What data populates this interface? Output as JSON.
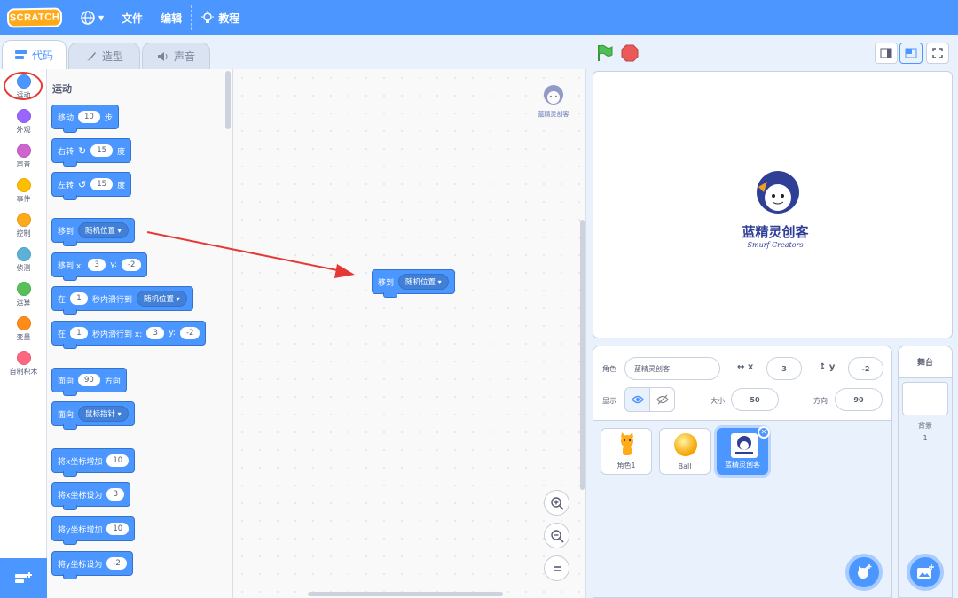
{
  "menubar": {
    "logo": "SCRATCH",
    "file": "文件",
    "edit": "编辑",
    "tutorials": "教程"
  },
  "tabs": [
    {
      "label": "代码"
    },
    {
      "label": "造型"
    },
    {
      "label": "声音"
    }
  ],
  "categories": [
    {
      "label": "运动",
      "color": "#4c97ff"
    },
    {
      "label": "外观",
      "color": "#9966ff"
    },
    {
      "label": "声音",
      "color": "#cf63cf"
    },
    {
      "label": "事件",
      "color": "#ffbf00"
    },
    {
      "label": "控制",
      "color": "#ffab19"
    },
    {
      "label": "侦测",
      "color": "#5cb1d6"
    },
    {
      "label": "运算",
      "color": "#59c059"
    },
    {
      "label": "变量",
      "color": "#ff8c1a"
    },
    {
      "label": "自制积木",
      "color": "#ff6680"
    }
  ],
  "palette": {
    "title": "运动",
    "blocks": {
      "move": {
        "a": "移动",
        "n": "10",
        "b": "步"
      },
      "turn_right": {
        "a": "右转",
        "n": "15",
        "b": "度"
      },
      "turn_left": {
        "a": "左转",
        "n": "15",
        "b": "度"
      },
      "goto": {
        "a": "移到",
        "menu": "随机位置"
      },
      "goto_xy": {
        "a": "移到 x:",
        "x": "3",
        "ylbl": "y:",
        "y": "-2"
      },
      "glide": {
        "a": "在",
        "n": "1",
        "b": "秒内滑行到",
        "menu": "随机位置"
      },
      "glide_xy": {
        "a": "在",
        "n": "1",
        "b": "秒内滑行到 x:",
        "x": "3",
        "ylbl": "y:",
        "y": "-2"
      },
      "point_dir": {
        "a": "面向",
        "n": "90",
        "b": "方向"
      },
      "point_towards": {
        "a": "面向",
        "menu": "鼠标指针"
      },
      "change_x": {
        "a": "将x坐标增加",
        "n": "10"
      },
      "set_x": {
        "a": "将x坐标设为",
        "n": "3"
      },
      "change_y": {
        "a": "将y坐标增加",
        "n": "10"
      },
      "set_y": {
        "a": "将y坐标设为",
        "n": "-2"
      }
    }
  },
  "workspace": {
    "block": {
      "a": "移到",
      "menu": "随机位置"
    },
    "watermark": "蓝精灵创客"
  },
  "stage": {
    "logo_cn": "蓝精灵创客",
    "logo_en": "Smurf Creators"
  },
  "sprite_info": {
    "sprite_label": "角色",
    "sprite_name": "蓝精灵创客",
    "x_label": "x",
    "x": "3",
    "y_label": "y",
    "y": "-2",
    "show_label": "显示",
    "size_label": "大小",
    "size": "50",
    "direction_label": "方向",
    "direction": "90"
  },
  "sprites": [
    {
      "name": "角色1"
    },
    {
      "name": "Ball"
    },
    {
      "name": "蓝精灵创客"
    }
  ],
  "stage_pane": {
    "title": "舞台",
    "backdrop_label": "背景",
    "backdrop_count": "1"
  },
  "colors": {
    "motion": "#4c97ff",
    "arrow": "#e53935",
    "highlight_circle": "#e53935"
  }
}
